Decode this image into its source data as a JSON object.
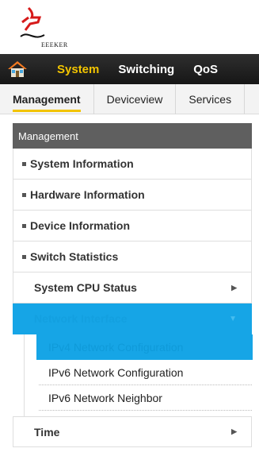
{
  "logo": {
    "text": "EEEKER"
  },
  "topnav": {
    "items": [
      {
        "label": "System",
        "active": true
      },
      {
        "label": "Switching",
        "active": false
      },
      {
        "label": "QoS",
        "active": false
      }
    ]
  },
  "subnav": {
    "items": [
      {
        "label": "Management",
        "active": true
      },
      {
        "label": "Deviceview",
        "active": false
      },
      {
        "label": "Services",
        "active": false
      }
    ]
  },
  "sidebar": {
    "header": "Management",
    "items": [
      {
        "label": "System Information"
      },
      {
        "label": "Hardware Information"
      },
      {
        "label": "Device Information"
      },
      {
        "label": "Switch Statistics"
      },
      {
        "label": "System CPU Status"
      },
      {
        "label": "Network Interface"
      },
      {
        "label": "Time"
      }
    ],
    "network_interface_children": [
      {
        "label": "IPv4 Network Configuration"
      },
      {
        "label": "IPv6 Network Configuration"
      },
      {
        "label": "IPv6 Network Neighbor"
      }
    ]
  },
  "colors": {
    "accent_blue": "#16a5e6",
    "accent_yellow": "#f2c400",
    "nav_dark": "#222222"
  },
  "icons": [
    "home-icon",
    "chevron-right-icon",
    "chevron-down-icon"
  ]
}
